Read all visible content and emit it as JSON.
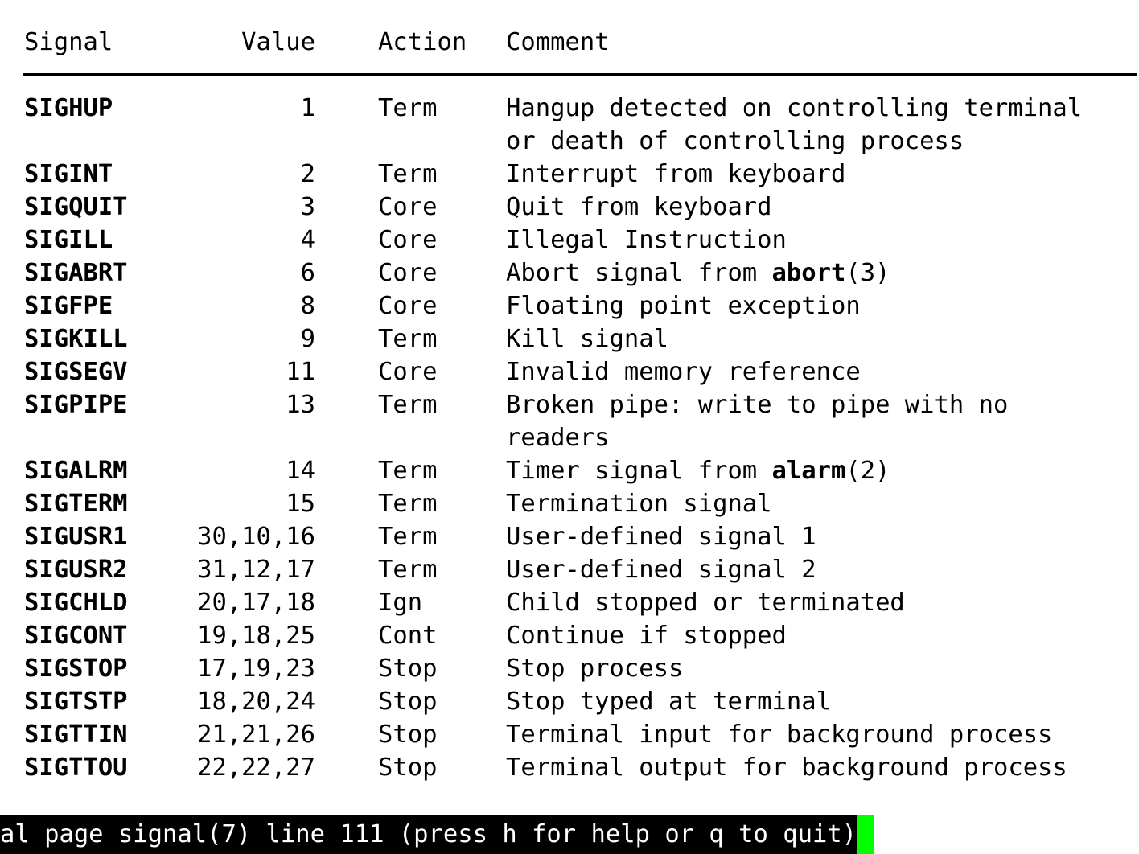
{
  "page": {
    "title": "signal(7)",
    "background_color": "#ffffff",
    "text_color": "#000000"
  },
  "table": {
    "headers": {
      "signal": "Signal",
      "value": "Value",
      "action": "Action",
      "comment": "Comment"
    },
    "rows": [
      {
        "signal": "SIGHUP",
        "value": "1",
        "action": "Term",
        "comment": "Hangup detected on controlling terminal",
        "comment_cont": "or death of controlling process"
      },
      {
        "signal": "SIGINT",
        "value": "2",
        "action": "Term",
        "comment": "Interrupt from keyboard"
      },
      {
        "signal": "SIGQUIT",
        "value": "3",
        "action": "Core",
        "comment": "Quit from keyboard"
      },
      {
        "signal": "SIGILL",
        "value": "4",
        "action": "Core",
        "comment": "Illegal Instruction"
      },
      {
        "signal": "SIGABRT",
        "value": "6",
        "action": "Core",
        "comment_pre": "Abort signal from ",
        "comment_fn": "abort",
        "comment_post": "(3)"
      },
      {
        "signal": "SIGFPE",
        "value": "8",
        "action": "Core",
        "comment": "Floating point exception"
      },
      {
        "signal": "SIGKILL",
        "value": "9",
        "action": "Term",
        "comment": "Kill signal"
      },
      {
        "signal": "SIGSEGV",
        "value": "11",
        "action": "Core",
        "comment": "Invalid memory reference"
      },
      {
        "signal": "SIGPIPE",
        "value": "13",
        "action": "Term",
        "comment": "Broken pipe: write to pipe with no",
        "comment_cont": "readers"
      },
      {
        "signal": "SIGALRM",
        "value": "14",
        "action": "Term",
        "comment_pre": "Timer signal from ",
        "comment_fn": "alarm",
        "comment_post": "(2)"
      },
      {
        "signal": "SIGTERM",
        "value": "15",
        "action": "Term",
        "comment": "Termination signal"
      },
      {
        "signal": "SIGUSR1",
        "value": "30,10,16",
        "action": "Term",
        "comment": "User-defined signal 1"
      },
      {
        "signal": "SIGUSR2",
        "value": "31,12,17",
        "action": "Term",
        "comment": "User-defined signal 2"
      },
      {
        "signal": "SIGCHLD",
        "value": "20,17,18",
        "action": "Ign",
        "comment": "Child stopped or terminated"
      },
      {
        "signal": "SIGCONT",
        "value": "19,18,25",
        "action": "Cont",
        "comment": "Continue if stopped"
      },
      {
        "signal": "SIGSTOP",
        "value": "17,19,23",
        "action": "Stop",
        "comment": "Stop process"
      },
      {
        "signal": "SIGTSTP",
        "value": "18,20,24",
        "action": "Stop",
        "comment": "Stop typed at terminal"
      },
      {
        "signal": "SIGTTIN",
        "value": "21,21,26",
        "action": "Stop",
        "comment": "Terminal input for background process"
      },
      {
        "signal": "SIGTTOU",
        "value": "22,22,27",
        "action": "Stop",
        "comment": "Terminal output for background process"
      }
    ]
  },
  "status_bar": {
    "text": "al page signal(7) line 111 (press h for help or q to quit)",
    "background_color": "#000000",
    "text_color": "#ffffff",
    "cursor_color": "#00ff00"
  }
}
